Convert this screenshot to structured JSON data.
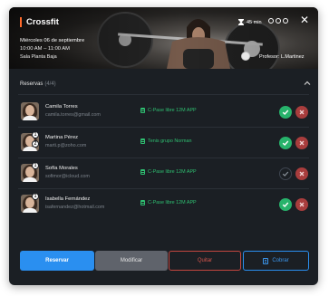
{
  "header": {
    "title": "Crossfit",
    "date": "Miércoles 06 de septiembre",
    "time": "10:00 AM – 11:00 AM",
    "room": "Sala Planta Baja",
    "duration": "45 min",
    "trainer": "Profesor: L.Martinez",
    "accent_color": "#ff6a2b"
  },
  "reservations": {
    "label": "Reservas",
    "count": "(4/4)",
    "rows": [
      {
        "name": "Camila Torres",
        "email": "camila.torres@gmail.com",
        "plan": "C-Pase libre 12M APP",
        "status": "confirmed",
        "badges": []
      },
      {
        "name": "Martina Pérez",
        "email": "marti.p@zoho.com",
        "plan": "Tenis grupo Norman",
        "status": "confirmed",
        "badges": [
          "1",
          "2"
        ]
      },
      {
        "name": "Sofía Morales",
        "email": "sofimor@icloud.com",
        "plan": "C-Pase libre 12M APP",
        "status": "pending",
        "badges": [
          "1"
        ]
      },
      {
        "name": "Isabella Fernández",
        "email": "isafernandez@hotmail.com",
        "plan": "C-Pase libre 12M APP",
        "status": "confirmed",
        "badges": [
          "1"
        ]
      }
    ]
  },
  "actions": {
    "reservar": "Reservar",
    "modificar": "Modificar",
    "quitar": "Quitar",
    "cobrar": "Cobrar"
  },
  "colors": {
    "confirm": "#27b36b",
    "reject": "#a83d3d",
    "primary": "#2a8ff0",
    "danger": "#c3463f",
    "plan_text": "#2fbf71"
  },
  "icons": [
    "hourglass-icon",
    "people-icon",
    "close-icon",
    "chevron-up-icon",
    "check-icon",
    "x-icon",
    "document-icon",
    "cash-register-icon"
  ]
}
